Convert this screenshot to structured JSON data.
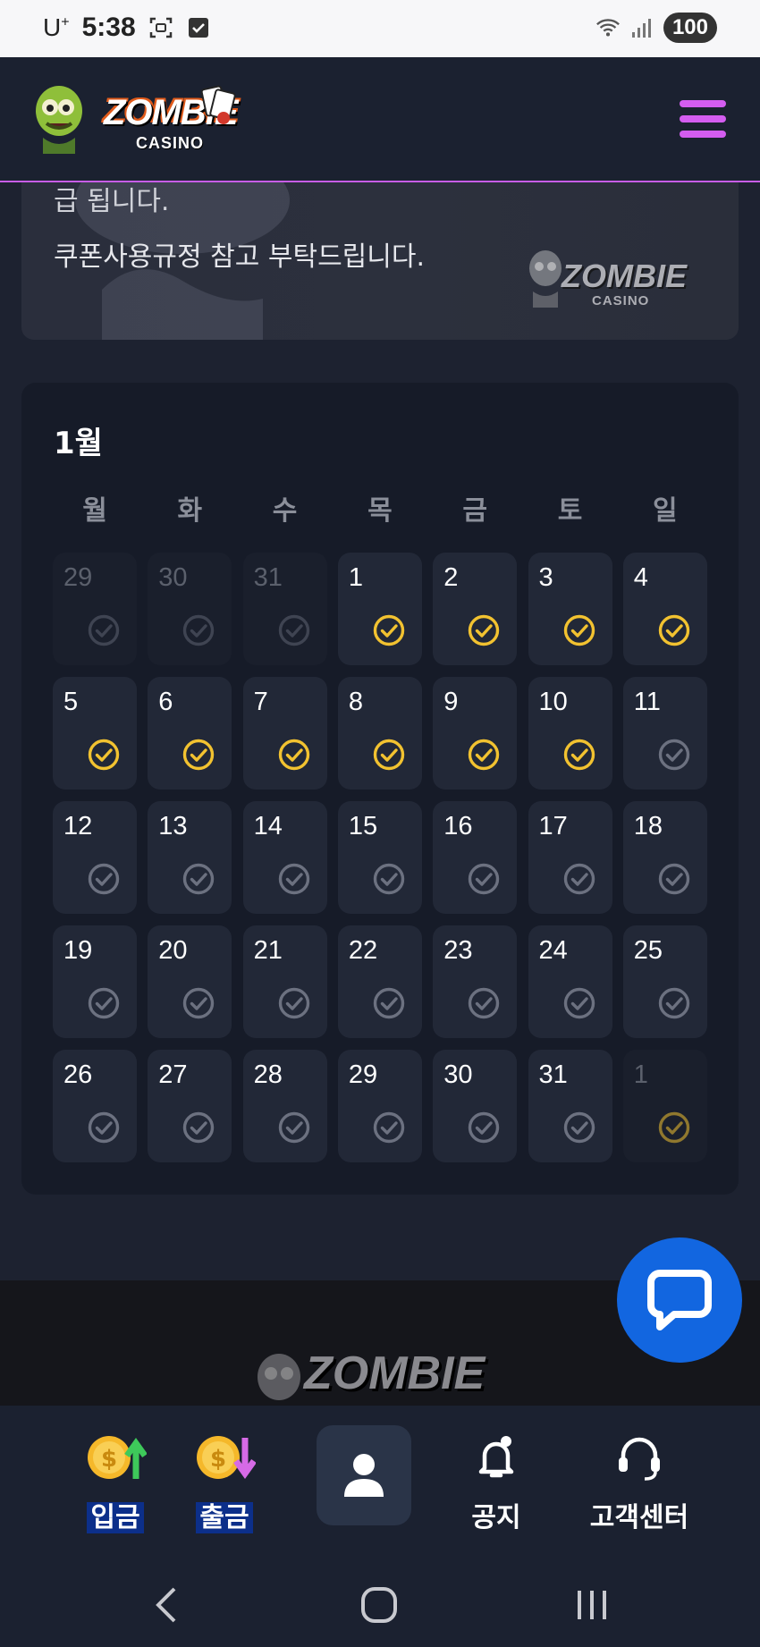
{
  "status_bar": {
    "carrier": "U",
    "carrier_sup": "+",
    "time": "5:38",
    "battery": "100"
  },
  "header": {
    "logo_text": "ZOMBIE",
    "logo_sub": "CASINO",
    "menu_icon": "hamburger-icon"
  },
  "banner": {
    "line1": "급 됩니다.",
    "line2": "쿠폰사용규정 참고 부탁드립니다.",
    "logo_text": "ZOMBIE",
    "logo_sub": "CASINO"
  },
  "calendar": {
    "month": "1월",
    "weekdays": [
      "월",
      "화",
      "수",
      "목",
      "금",
      "토",
      "일"
    ],
    "check_color_done": "#f2c230",
    "check_color_pending": "#6c7180",
    "days": [
      {
        "num": "29",
        "muted": true,
        "checked": false
      },
      {
        "num": "30",
        "muted": true,
        "checked": false
      },
      {
        "num": "31",
        "muted": true,
        "checked": false
      },
      {
        "num": "1",
        "muted": false,
        "checked": true
      },
      {
        "num": "2",
        "muted": false,
        "checked": true
      },
      {
        "num": "3",
        "muted": false,
        "checked": true
      },
      {
        "num": "4",
        "muted": false,
        "checked": true
      },
      {
        "num": "5",
        "muted": false,
        "checked": true
      },
      {
        "num": "6",
        "muted": false,
        "checked": true
      },
      {
        "num": "7",
        "muted": false,
        "checked": true
      },
      {
        "num": "8",
        "muted": false,
        "checked": true
      },
      {
        "num": "9",
        "muted": false,
        "checked": true
      },
      {
        "num": "10",
        "muted": false,
        "checked": true
      },
      {
        "num": "11",
        "muted": false,
        "checked": false
      },
      {
        "num": "12",
        "muted": false,
        "checked": false
      },
      {
        "num": "13",
        "muted": false,
        "checked": false
      },
      {
        "num": "14",
        "muted": false,
        "checked": false
      },
      {
        "num": "15",
        "muted": false,
        "checked": false
      },
      {
        "num": "16",
        "muted": false,
        "checked": false
      },
      {
        "num": "17",
        "muted": false,
        "checked": false
      },
      {
        "num": "18",
        "muted": false,
        "checked": false
      },
      {
        "num": "19",
        "muted": false,
        "checked": false
      },
      {
        "num": "20",
        "muted": false,
        "checked": false
      },
      {
        "num": "21",
        "muted": false,
        "checked": false
      },
      {
        "num": "22",
        "muted": false,
        "checked": false
      },
      {
        "num": "23",
        "muted": false,
        "checked": false
      },
      {
        "num": "24",
        "muted": false,
        "checked": false
      },
      {
        "num": "25",
        "muted": false,
        "checked": false
      },
      {
        "num": "26",
        "muted": false,
        "checked": false
      },
      {
        "num": "27",
        "muted": false,
        "checked": false
      },
      {
        "num": "28",
        "muted": false,
        "checked": false
      },
      {
        "num": "29",
        "muted": false,
        "checked": false
      },
      {
        "num": "30",
        "muted": false,
        "checked": false
      },
      {
        "num": "31",
        "muted": false,
        "checked": false
      },
      {
        "num": "1",
        "muted": true,
        "checked": true
      }
    ]
  },
  "footer": {
    "logo_text": "ZOMBIE"
  },
  "chat_button": {
    "icon": "chat-bubble-icon"
  },
  "bottom_nav": {
    "deposit": "입금",
    "withdraw": "출금",
    "notice": "공지",
    "support": "고객센터",
    "profile_icon": "user-icon"
  },
  "system_nav": {
    "back": "back-icon",
    "home": "home-icon",
    "recents": "recents-icon"
  }
}
